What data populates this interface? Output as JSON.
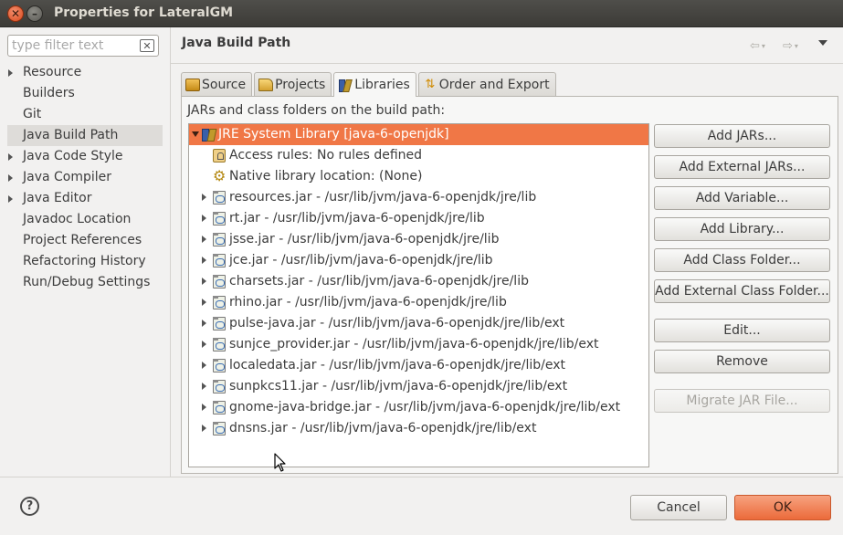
{
  "window": {
    "title": "Properties for LateralGM",
    "close_glyph": "✕",
    "minimize_glyph": "–"
  },
  "sidebar": {
    "filter_placeholder": "type filter text",
    "filter_value": "",
    "items": [
      {
        "label": "Resource",
        "expandable": true
      },
      {
        "label": "Builders",
        "expandable": false
      },
      {
        "label": "Git",
        "expandable": false
      },
      {
        "label": "Java Build Path",
        "expandable": false,
        "selected": true
      },
      {
        "label": "Java Code Style",
        "expandable": true
      },
      {
        "label": "Java Compiler",
        "expandable": true
      },
      {
        "label": "Java Editor",
        "expandable": true
      },
      {
        "label": "Javadoc Location",
        "expandable": false
      },
      {
        "label": "Project References",
        "expandable": false
      },
      {
        "label": "Refactoring History",
        "expandable": false
      },
      {
        "label": "Run/Debug Settings",
        "expandable": false
      }
    ]
  },
  "page": {
    "title": "Java Build Path",
    "back_glyph": "⇦",
    "forward_glyph": "⇨",
    "dropdown_glyph": "▾"
  },
  "tabs": [
    {
      "label": "Source",
      "icon": "source-folder-icon"
    },
    {
      "label": "Projects",
      "icon": "projects-folder-icon"
    },
    {
      "label": "Libraries",
      "icon": "libraries-icon",
      "active": true
    },
    {
      "label": "Order and Export",
      "icon": "order-export-icon"
    }
  ],
  "libraries": {
    "heading": "JARs and class folders on the build path:",
    "tree": [
      {
        "label": "JRE System Library [java-6-openjdk]",
        "level": 0,
        "twisty": "open",
        "icon": "jre-library-icon",
        "selected": true
      },
      {
        "label": "Access rules: No rules defined",
        "level": 1,
        "twisty": "none",
        "icon": "access-rules-icon"
      },
      {
        "label": "Native library location: (None)",
        "level": 1,
        "twisty": "none",
        "icon": "native-library-icon"
      },
      {
        "label": "resources.jar - /usr/lib/jvm/java-6-openjdk/jre/lib",
        "level": 1,
        "twisty": "closed",
        "icon": "jar-icon"
      },
      {
        "label": "rt.jar - /usr/lib/jvm/java-6-openjdk/jre/lib",
        "level": 1,
        "twisty": "closed",
        "icon": "jar-icon"
      },
      {
        "label": "jsse.jar - /usr/lib/jvm/java-6-openjdk/jre/lib",
        "level": 1,
        "twisty": "closed",
        "icon": "jar-icon"
      },
      {
        "label": "jce.jar - /usr/lib/jvm/java-6-openjdk/jre/lib",
        "level": 1,
        "twisty": "closed",
        "icon": "jar-icon"
      },
      {
        "label": "charsets.jar - /usr/lib/jvm/java-6-openjdk/jre/lib",
        "level": 1,
        "twisty": "closed",
        "icon": "jar-icon"
      },
      {
        "label": "rhino.jar - /usr/lib/jvm/java-6-openjdk/jre/lib",
        "level": 1,
        "twisty": "closed",
        "icon": "jar-icon"
      },
      {
        "label": "pulse-java.jar - /usr/lib/jvm/java-6-openjdk/jre/lib/ext",
        "level": 1,
        "twisty": "closed",
        "icon": "jar-icon"
      },
      {
        "label": "sunjce_provider.jar - /usr/lib/jvm/java-6-openjdk/jre/lib/ext",
        "level": 1,
        "twisty": "closed",
        "icon": "jar-icon"
      },
      {
        "label": "localedata.jar - /usr/lib/jvm/java-6-openjdk/jre/lib/ext",
        "level": 1,
        "twisty": "closed",
        "icon": "jar-icon"
      },
      {
        "label": "sunpkcs11.jar - /usr/lib/jvm/java-6-openjdk/jre/lib/ext",
        "level": 1,
        "twisty": "closed",
        "icon": "jar-icon"
      },
      {
        "label": "gnome-java-bridge.jar - /usr/lib/jvm/java-6-openjdk/jre/lib/ext",
        "level": 1,
        "twisty": "closed",
        "icon": "jar-icon"
      },
      {
        "label": "dnsns.jar - /usr/lib/jvm/java-6-openjdk/jre/lib/ext",
        "level": 1,
        "twisty": "closed",
        "icon": "jar-icon"
      }
    ],
    "buttons": {
      "add_jars": "Add JARs...",
      "add_external_jars": "Add External JARs...",
      "add_variable": "Add Variable...",
      "add_library": "Add Library...",
      "add_class_folder": "Add Class Folder...",
      "add_external_class_folder": "Add External Class Folder...",
      "edit": "Edit...",
      "remove": "Remove",
      "migrate_jar_file": "Migrate JAR File..."
    }
  },
  "footer": {
    "help_glyph": "?",
    "cancel": "Cancel",
    "ok": "OK"
  },
  "colors": {
    "selection": "#f07746",
    "ok_button": "#eb6a3a",
    "titlebar": "#3c3b37"
  }
}
